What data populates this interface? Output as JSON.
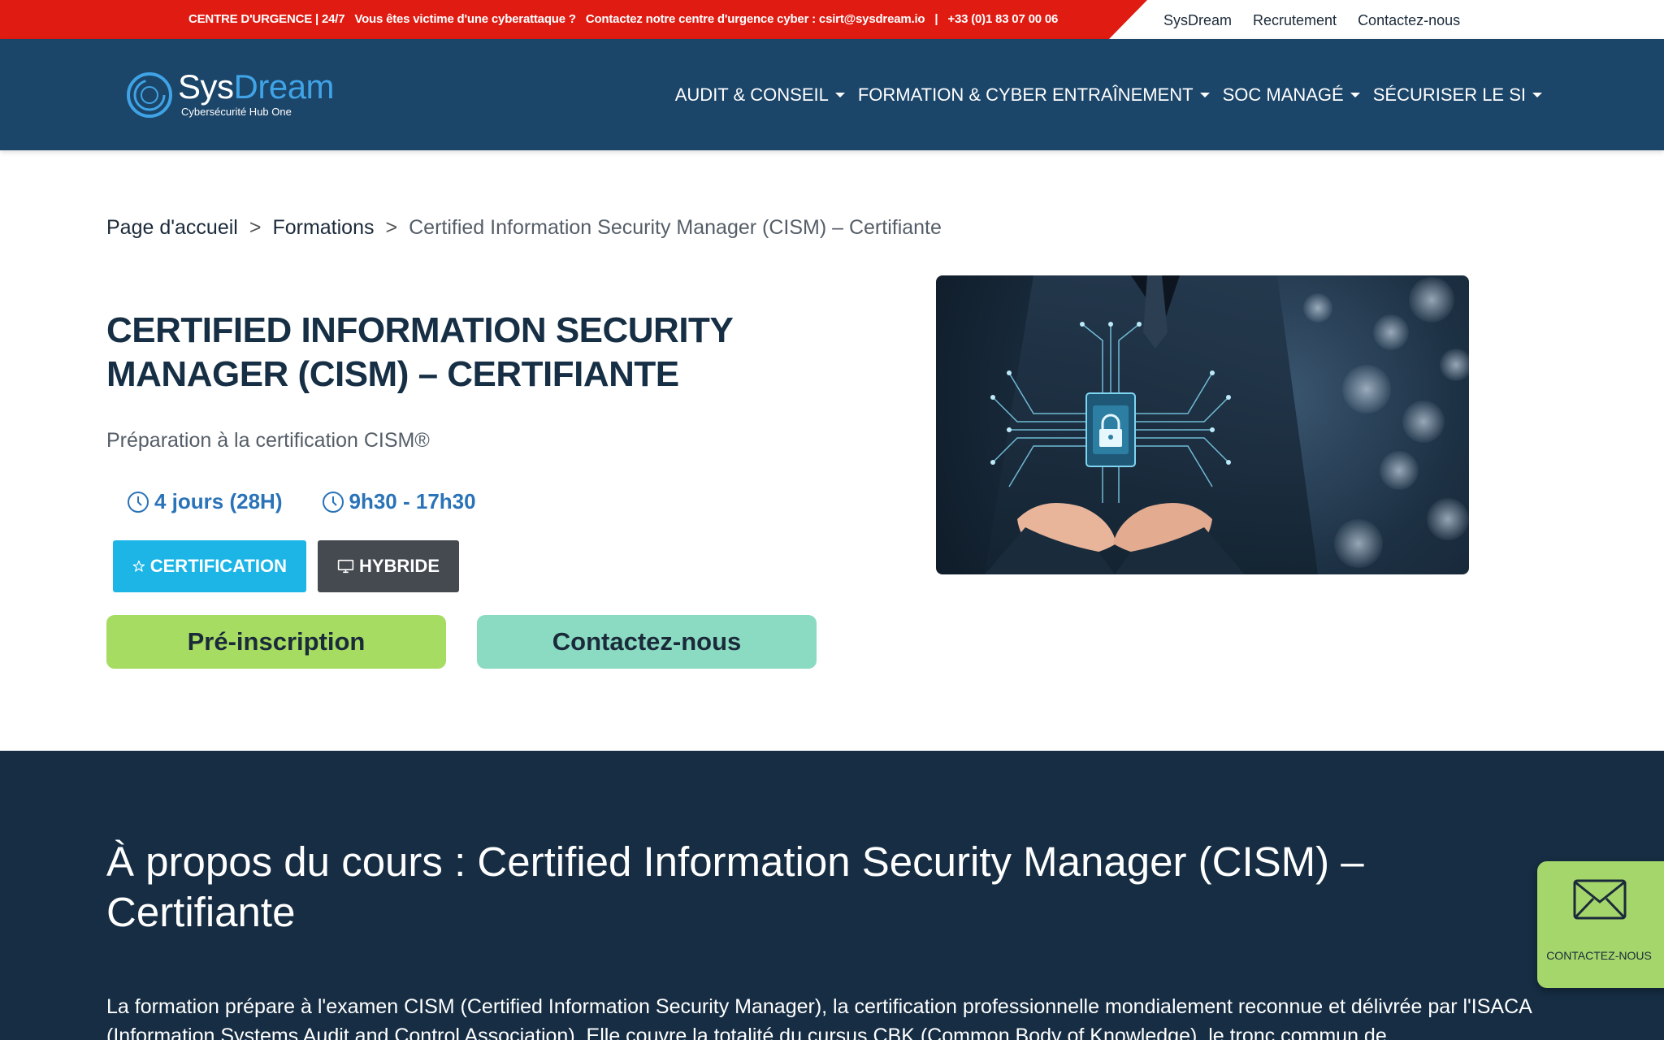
{
  "topbar": {
    "urgency_title": "CENTRE D'URGENCE | 24/7",
    "urgency_question": "Vous êtes victime d'une cyberattaque ?",
    "urgency_contact": "Contactez notre centre d'urgence cyber : csirt@sysdream.io",
    "urgency_sep": "|",
    "urgency_phone": "+33 (0)1 83 07 00 06",
    "urgency_color": "#e01b12",
    "links": [
      "SysDream",
      "Recrutement",
      "Contactez-nous"
    ]
  },
  "header": {
    "logo_sys": "Sys",
    "logo_dream": "Dream",
    "logo_sub": "Cybersécurité Hub One",
    "bg_color": "#1b4569",
    "nav": [
      "AUDIT & CONSEIL",
      "FORMATION & CYBER ENTRAÎNEMENT",
      "SOC MANAGÉ",
      "SÉCURISER LE SI"
    ]
  },
  "breadcrumb": {
    "home": "Page d'accueil",
    "sep": ">",
    "section": "Formations",
    "current": "Certified Information Security Manager (CISM) – Certifiante"
  },
  "course": {
    "title": "CERTIFIED INFORMATION SECURITY MANAGER (CISM) – CERTIFIANTE",
    "subtitle": "Préparation à la certification CISM®",
    "duration": "4 jours (28H)",
    "hours": "9h30 - 17h30",
    "badge_cert": "CERTIFICATION",
    "badge_mode": "HYBRIDE",
    "cta_pre": "Pré-inscription",
    "cta_contact": "Contactez-nous"
  },
  "about": {
    "heading": "À propos du cours : Certified Information Security Manager (CISM) – Certifiante",
    "text": "La formation prépare à l'examen CISM (Certified Information Security Manager), la certification professionnelle mondialement reconnue et délivrée par l'ISACA (Information Systems Audit and Control Association). Elle couvre la totalité du cursus CBK (Common Body of Knowledge), le tronc commun de"
  },
  "floating": {
    "label": "CONTACTEZ-NOUS"
  },
  "colors": {
    "cert_badge": "#1cb5e6",
    "mode_badge": "#454a50",
    "cta_pre": "#a5dc61",
    "cta_contact": "#8adbc1",
    "dark_section": "#162d43",
    "accent_blue": "#2a73b8"
  }
}
